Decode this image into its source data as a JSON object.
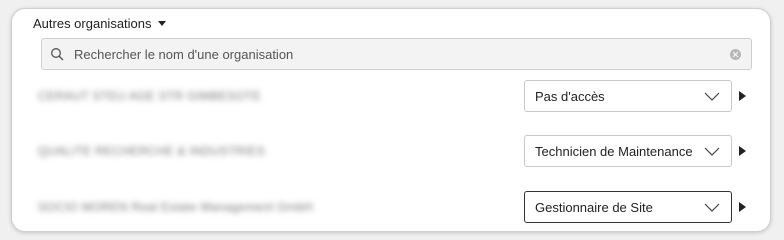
{
  "section": {
    "title": "Autres organisations",
    "toggle_icon": "caret-down-icon"
  },
  "search": {
    "placeholder": "Rechercher le nom d'une organisation",
    "value": ""
  },
  "organizations": [
    {
      "name": "CERAUT STEU AGE STR GIMBESOTE",
      "role": "Pas d'accès"
    },
    {
      "name": "QUALITE RECHERCHE & INDUSTRIES",
      "role": "Technicien de Maintenance"
    },
    {
      "name": "SOCIO MOREN Real Estate Management GmbH",
      "role": "Gestionnaire de Site"
    }
  ]
}
